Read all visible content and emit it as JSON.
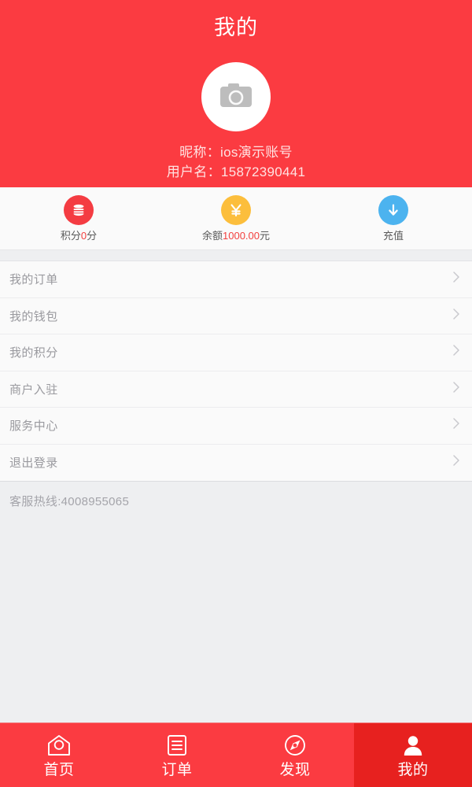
{
  "theme": {
    "brand_red": "#fb3b41",
    "active_tab_red": "#e7211f",
    "points_circle": "#f43c42",
    "balance_circle": "#fcbe3c",
    "recharge_circle": "#4cb3ef",
    "value_red": "#f2413f",
    "page_bg": "#eeeff1",
    "panel_bg": "#fafafa"
  },
  "header": {
    "title": "我的",
    "avatar_icon": "camera-icon",
    "nickname_line": "昵称：ios演示账号",
    "username_line": "用户名：15872390441"
  },
  "stats": [
    {
      "icon": "coins-stack-icon",
      "prefix": "积分",
      "value": "0",
      "suffix": "分"
    },
    {
      "icon": "yuan-sign-icon",
      "prefix": "余额",
      "value": "1000.00",
      "suffix": "元"
    },
    {
      "icon": "download-arrow-icon",
      "prefix": "充值",
      "value": "",
      "suffix": ""
    }
  ],
  "menu": {
    "items": [
      {
        "label": "我的订单",
        "chevron": "chevron-right-icon"
      },
      {
        "label": "我的钱包",
        "chevron": "chevron-right-icon"
      },
      {
        "label": "我的积分",
        "chevron": "chevron-right-icon"
      },
      {
        "label": "商户入驻",
        "chevron": "chevron-right-icon"
      },
      {
        "label": "服务中心",
        "chevron": "chevron-right-icon"
      },
      {
        "label": "退出登录",
        "chevron": "chevron-right-icon"
      }
    ]
  },
  "hotline": {
    "text": "客服热线:4008955065"
  },
  "tabbar": {
    "items": [
      {
        "label": "首页",
        "icon": "home-pentagon-icon",
        "active": false
      },
      {
        "label": "订单",
        "icon": "order-list-icon",
        "active": false
      },
      {
        "label": "发现",
        "icon": "compass-icon",
        "active": false
      },
      {
        "label": "我的",
        "icon": "person-icon",
        "active": true
      }
    ]
  }
}
